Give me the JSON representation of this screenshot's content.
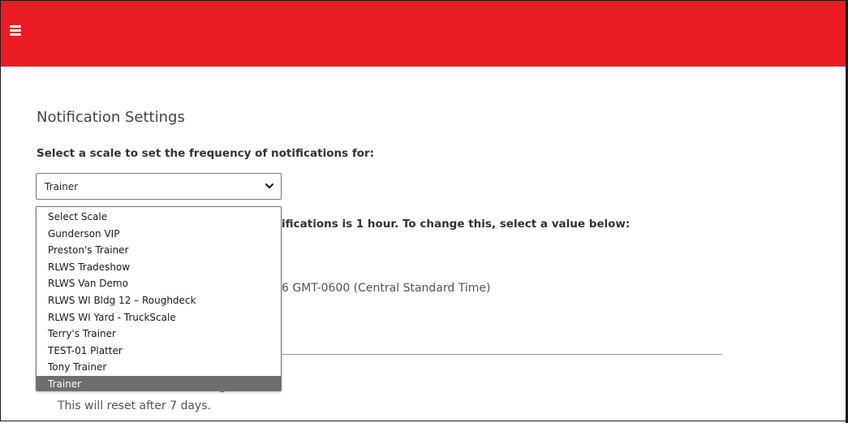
{
  "header": {
    "menu_icon": "hamburger-menu-icon",
    "color": "#ec1c24"
  },
  "page": {
    "title": "Notification Settings",
    "scale_label": "Select a scale to set the frequency of notifications for:",
    "frequency_text": "ifications is 1 hour. To change this, select a value below:",
    "date_text": "6 GMT-0600 (Central Standard Time)",
    "obscured_text": "g",
    "reset_text": "This will reset after 7 days."
  },
  "scale_select": {
    "value": "Trainer",
    "options": [
      "Select Scale",
      "Gunderson VIP",
      "Preston's Trainer",
      "RLWS Tradeshow",
      "RLWS Van Demo",
      "RLWS WI Bldg 12 – Roughdeck",
      "RLWS WI Yard - TruckScale",
      "Terry's Trainer",
      "TEST-01 Platter",
      "Tony Trainer",
      "Trainer"
    ],
    "selected_index": 10
  }
}
